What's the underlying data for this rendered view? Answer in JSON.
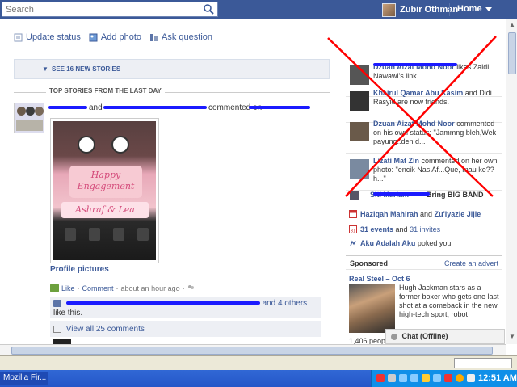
{
  "header": {
    "search_placeholder": "Search",
    "user_name": "Zubir Othman",
    "home_label": "Home"
  },
  "composer": {
    "update_status": "Update status",
    "add_photo": "Add photo",
    "ask_question": "Ask question"
  },
  "feed": {
    "see_new_stories": "SEE 16 NEW STORIES",
    "top_stories_header": "TOP STORIES FROM THE LAST DAY",
    "post_and": "and",
    "post_commented_on": "commented on",
    "photo_text_1": "Happy Engagement",
    "photo_text_2": "Ashraf & Lea",
    "album_name": "Profile pictures",
    "like_label": "Like",
    "comment_label": "Comment",
    "post_time": "about an hour ago",
    "likers_suffix": "and 4 others",
    "likers_suffix2": "like this.",
    "view_comments": "View all 25 comments"
  },
  "ticker": {
    "items": [
      {
        "name": "Dzuan Aizat Mohd Noor",
        "text": "likes Zaidi Nawawi's link."
      },
      {
        "name": "Khairul Qamar Abu Kasim",
        "text": "and Didi Rasyid are now friends."
      },
      {
        "name": "Dzuan Aizat Mohd Noor",
        "text": "commented on his own status: \"Jammng bleh,Wek payung..den d..."
      },
      {
        "name": "Lizati Mat Zin",
        "text": "commented on her own photo: \"encik Nas Af...Que, mau ke?? h...\""
      }
    ],
    "last_name": "Siti Mariam",
    "last_text": "Bring BIG BAND"
  },
  "right": {
    "birthday_name_1": "Haziqah Mahirah",
    "birthday_and": "and",
    "birthday_name_2": "Zu'iyazie Jijie",
    "events_count": "31 events",
    "events_and": "and",
    "invites": "31 invites",
    "poke_name": "Aku Adalah Aku",
    "poke_text": "poked you",
    "sponsored_label": "Sponsored",
    "create_advert": "Create an advert",
    "ad_title": "Real Steel – Oct 6",
    "ad_text": "Hugh Jackman stars as a former boxer who gets one last shot at a comeback in the new high-tech sport, robot",
    "ad_people": "1,406 peopl...",
    "chat_label": "Chat (Offline)"
  },
  "taskbar": {
    "task_label": "Mozilla Fir...",
    "clock": "12:51 AM"
  },
  "colors": {
    "facebook_blue": "#3b5998",
    "cross_red": "#ff0000",
    "scribble_blue": "#1b1bff"
  }
}
